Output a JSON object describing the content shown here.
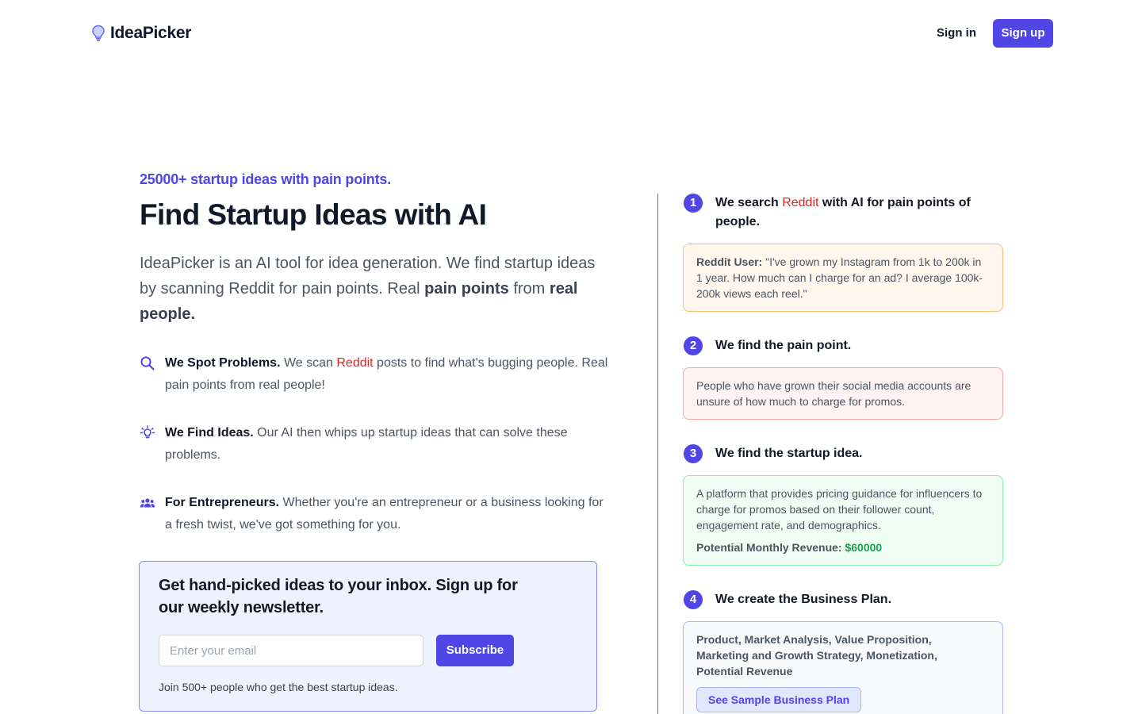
{
  "header": {
    "logo_text": "IdeaPicker",
    "logo_icon": "lightbulb-icon",
    "signin_label": "Sign in",
    "signup_label": "Sign up"
  },
  "hero": {
    "eyebrow": "25000+ startup ideas with pain points.",
    "title": "Find Startup Ideas with AI",
    "lead_part1": "IdeaPicker is an AI tool for idea generation. We find startup ideas by scanning Reddit for pain points. Real ",
    "lead_bold1": "pain points",
    "lead_part2": " from ",
    "lead_bold2": "real people."
  },
  "features": [
    {
      "icon": "search-icon",
      "title": "We Spot Problems.",
      "text_before": " We scan ",
      "highlight": "Reddit",
      "text_after": " posts to find what's bugging people. Real pain points from real people!"
    },
    {
      "icon": "lightbulb-icon",
      "title": "We Find Ideas.",
      "text": " Our AI then whips up startup ideas that can solve these problems."
    },
    {
      "icon": "users-icon",
      "title": "For Entrepreneurs.",
      "text": " Whether you're an entrepreneur or a business looking for a fresh twist, we've got something for you."
    }
  ],
  "newsletter": {
    "title": "Get hand-picked ideas to your inbox. Sign up for our weekly newsletter.",
    "input_placeholder": "Enter your email",
    "input_value": "",
    "button_label": "Subscribe",
    "note": "Join 500+ people who get the best startup ideas."
  },
  "steps": [
    {
      "number": "1",
      "title_before": "We search ",
      "title_highlight": "Reddit",
      "title_after": " with AI for pain points of people.",
      "box_label": "Reddit User:",
      "box_text": " \"I've grown my Instagram from 1k to 200k in 1 year. How much can I charge for an ad? I average 100k-200k views each reel.\""
    },
    {
      "number": "2",
      "title": "We find the pain point.",
      "box_text": "People who have grown their social media accounts are unsure of how much to charge for promos."
    },
    {
      "number": "3",
      "title": "We find the startup idea.",
      "box_text": "A platform that provides pricing guidance for influencers to charge for promos based on their follower count, engagement rate, and demographics.",
      "revenue_label": "Potential Monthly Revenue:",
      "revenue_value": "$60000"
    },
    {
      "number": "4",
      "title": "We create the Business Plan.",
      "box_text": "Product, Market Analysis, Value Proposition, Marketing and Growth Strategy, Monetization, Potential Revenue",
      "button_label": "See Sample Business Plan"
    }
  ],
  "colors": {
    "accent": "#4f46e5",
    "reddit_red": "#dc2626",
    "revenue_green": "#16a34a"
  }
}
